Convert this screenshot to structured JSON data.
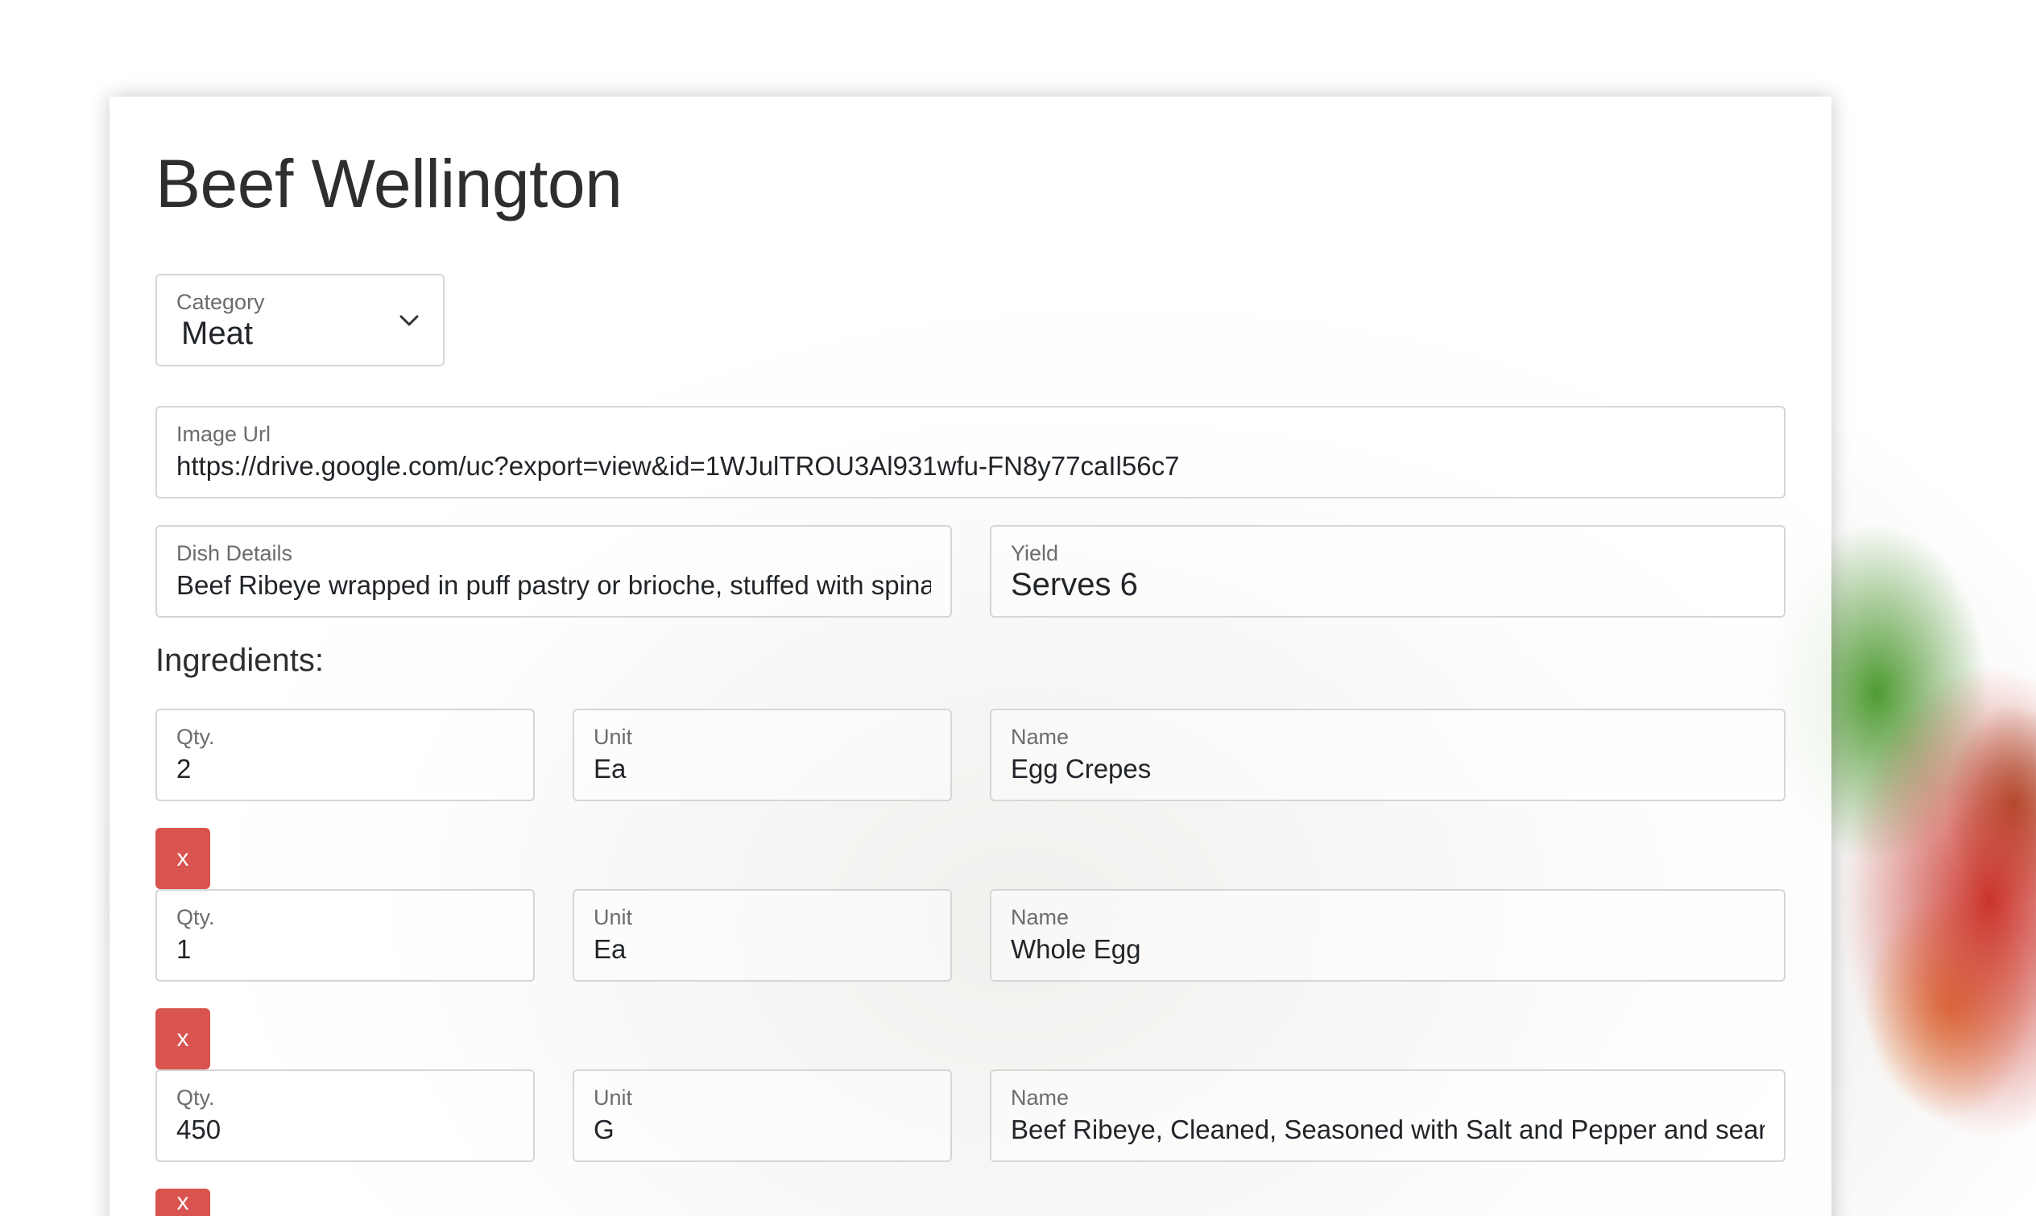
{
  "recipe": {
    "title": "Beef Wellington",
    "category": {
      "label": "Category",
      "value": "Meat"
    },
    "image_url": {
      "label": "Image Url",
      "value": "https://drive.google.com/uc?export=view&id=1WJulTROU3Al931wfu-FN8y77caIl56c7"
    },
    "dish_details": {
      "label": "Dish Details",
      "value": "Beef Ribeye wrapped in puff pastry or brioche, stuffed with spinach"
    },
    "yield": {
      "label": "Yield",
      "value": "Serves 6"
    }
  },
  "ingredients": {
    "heading": "Ingredients:",
    "qty_label": "Qty.",
    "unit_label": "Unit",
    "name_label": "Name",
    "remove_label": "x",
    "items": [
      {
        "qty": "2",
        "unit": "Ea",
        "name": "Egg Crepes"
      },
      {
        "qty": "1",
        "unit": "Ea",
        "name": "Whole Egg"
      },
      {
        "qty": "450",
        "unit": "G",
        "name": "Beef Ribeye, Cleaned, Seasoned with Salt and Pepper and seared"
      }
    ]
  },
  "colors": {
    "remove_button": "#d9534f",
    "field_border": "#d6d6d6"
  }
}
